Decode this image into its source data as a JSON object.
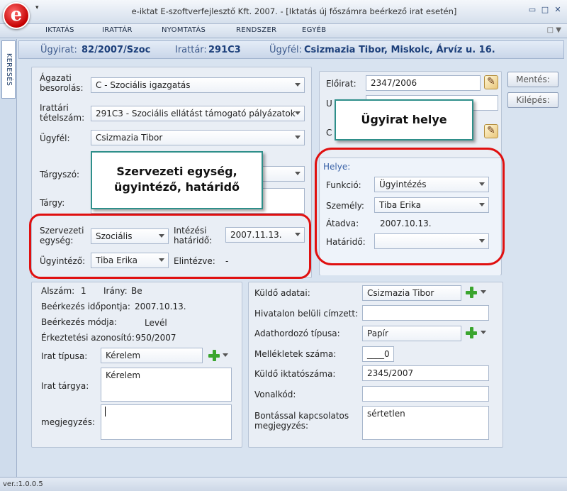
{
  "window": {
    "logo_letter": "e",
    "quick_access": "▾",
    "title": "e-iktat E-szoftverfejlesztő Kft. 2007. - [Iktatás új főszámra beérkező irat esetén]",
    "minimize": "▭",
    "maximize": "□",
    "close": "✕"
  },
  "menu": {
    "items": [
      "IKTATÁS",
      "IRATTÁR",
      "NYOMTATÁS",
      "RENDSZER",
      "EGYÉB"
    ],
    "end": "□ ▼"
  },
  "side_tab": "KERESÉS",
  "header": {
    "ugyirat_label": "Ügyirat:",
    "ugyirat_value": "82/2007/Szoc",
    "irattar_label": "Irattár:",
    "irattar_value": "291C3",
    "ugyfel_label": "Ügyfél:",
    "ugyfel_value": "Csizmazia Tibor, Miskolc, Árvíz u. 16."
  },
  "left_top": {
    "agazati_label": "Ágazati\nbesorolás:",
    "agazati_value": "C - Szociális igazgatás",
    "irattari_label": "Irattári\ntételszám:",
    "irattari_value": "291C3 - Szociális ellátást támogató pályázatok",
    "ugyfel_label": "Ügyfél:",
    "ugyfel_value": "Csizmazia Tibor",
    "targyszo_label": "Tárgyszó:",
    "targyszo_value": "",
    "targy_label": "Tárgy:",
    "targy_value": "",
    "szervezeti_label": "Szervezeti\negység:",
    "szervezeti_value": "Szociális",
    "intezesi_label": "Intézési\nhatáridő:",
    "intezesi_value": "2007.11.13.",
    "ugyintezo_label": "Ügyintéző:",
    "ugyintezo_value": "Tiba Erika",
    "elintezve_label": "Elintézve:",
    "elintezve_value": "-"
  },
  "right_top": {
    "eloirat_label": "Előirat:",
    "eloirat_value": "2347/2006",
    "u_label": "U",
    "c_label": "C",
    "helye_title": "Helye:",
    "funkcio_label": "Funkció:",
    "funkcio_value": "Ügyintézés",
    "szemely_label": "Személy:",
    "szemely_value": "Tiba Erika",
    "atadva_label": "Átadva:",
    "atadva_value": "2007.10.13.",
    "hatarido_label": "Határidő:",
    "hatarido_value": ""
  },
  "buttons": {
    "mentes": "Mentés:",
    "kilepes": "Kilépés:"
  },
  "callouts": {
    "szervezeti": "Szervezeti egység,\nügyintéző, határidő",
    "ugyirat_helye": "Ügyirat helye"
  },
  "left_bottom": {
    "alszam_label": "Alszám:",
    "alszam_value": "1",
    "irany_label": "Irány:",
    "irany_value": "Be",
    "beerkezes_idopont_label": "Beérkezés időpontja:",
    "beerkezes_idopont_value": "2007.10.13.",
    "beerkezes_mod_label": "Beérkezés módja:",
    "beerkezes_mod_value": "Levél",
    "erkeztetesi_label": "Érkeztetési azonosító:",
    "erkeztetesi_value": "950/2007",
    "irat_tipusa_label": "Irat típusa:",
    "irat_tipusa_value": "Kérelem",
    "irat_targya_label": "Irat tárgya:",
    "irat_targya_value": "Kérelem",
    "megjegyzes_label": "megjegyzés:",
    "megjegyzes_value": ""
  },
  "right_bottom": {
    "kuldo_adatai_label": "Küldő adatai:",
    "kuldo_adatai_value": "Csizmazia Tibor",
    "hivatalon_label": "Hivatalon belüli címzett:",
    "hivatalon_value": "",
    "adathordozo_label": "Adathordozó típusa:",
    "adathordozo_value": "Papír",
    "mellekletek_label": "Mellékletek száma:",
    "mellekletek_value": "____0",
    "kuldo_iktato_label": "Küldő iktatószáma:",
    "kuldo_iktato_value": "2345/2007",
    "vonalkod_label": "Vonalkód:",
    "vonalkod_value": "",
    "bontas_label": "Bontással kapcsolatos\nmegjegyzés:",
    "bontas_value": "sértetlen"
  },
  "status": {
    "version": "ver.:1.0.0.5"
  }
}
